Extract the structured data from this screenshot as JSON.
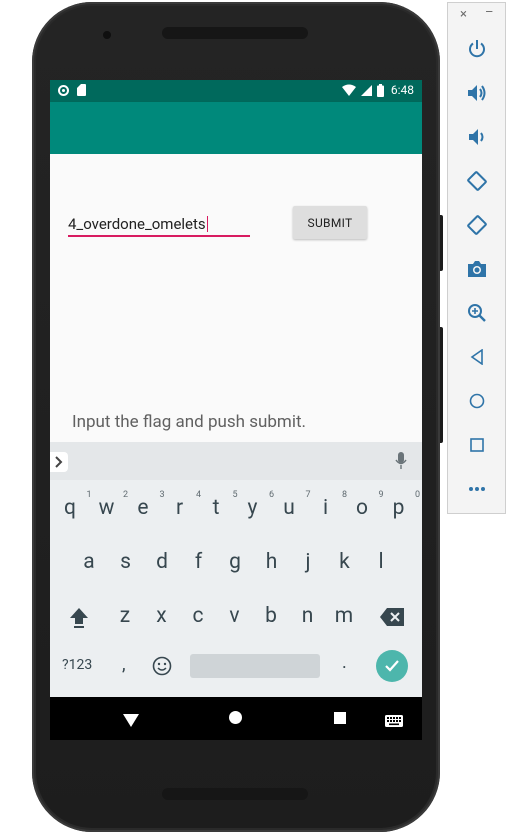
{
  "status_bar": {
    "time": "6:48"
  },
  "input": {
    "value": "4_overdone_omelets"
  },
  "submit_label": "SUBMIT",
  "instruction": "Input the flag and push submit.",
  "keyboard": {
    "row1": [
      "q",
      "w",
      "e",
      "r",
      "t",
      "y",
      "u",
      "i",
      "o",
      "p"
    ],
    "row1_hints": [
      "1",
      "2",
      "3",
      "4",
      "5",
      "6",
      "7",
      "8",
      "9",
      "0"
    ],
    "row2": [
      "a",
      "s",
      "d",
      "f",
      "g",
      "h",
      "j",
      "k",
      "l"
    ],
    "row3": [
      "z",
      "x",
      "c",
      "v",
      "b",
      "n",
      "m"
    ],
    "sym_label": "?123",
    "comma_label": ",",
    "period_label": "."
  },
  "toolbar": {
    "close_label": "×",
    "min_label": "–"
  },
  "colors": {
    "status_bar": "#00695c",
    "app_bar": "#00897b",
    "input_underline": "#d81b60",
    "enter_button": "#4db6ac"
  }
}
